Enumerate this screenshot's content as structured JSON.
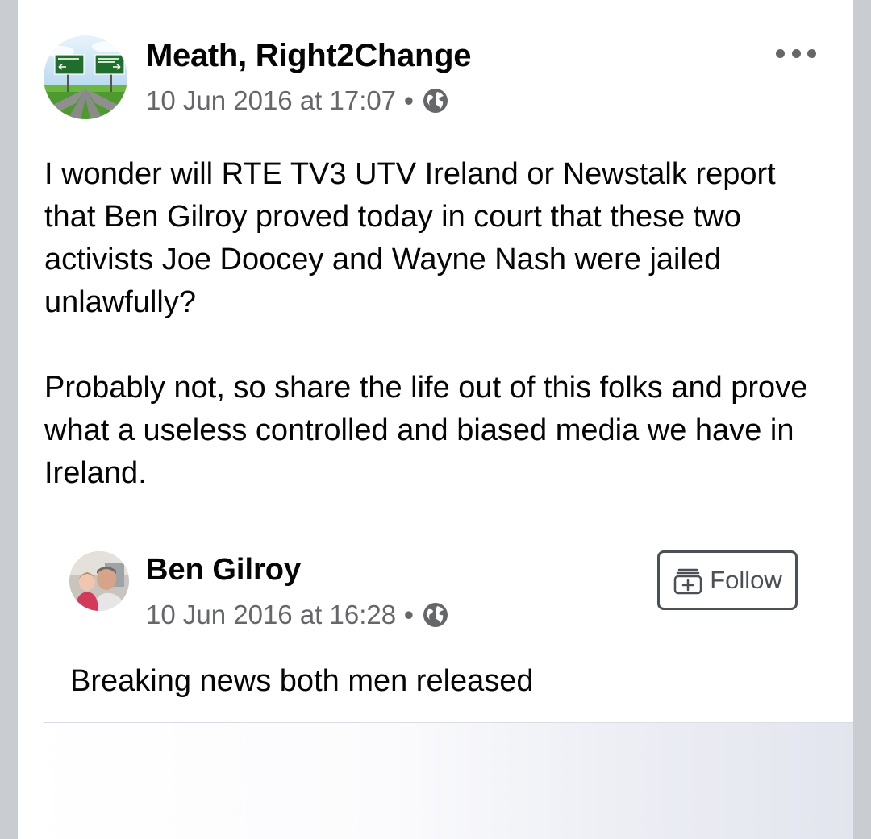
{
  "post": {
    "author": "Meath, Right2Change",
    "timestamp": "10 Jun 2016 at 17:07",
    "separator": "•",
    "audience_icon": "globe-icon",
    "paragraphs": [
      "I wonder will RTE TV3 UTV Ireland or Newstalk report that Ben Gilroy proved today in court that these two activists Joe Doocey and Wayne Nash were jailed unlawfully?",
      "Probably not,  so share the life out of this folks and prove what a useless controlled and biased media we have in Ireland."
    ],
    "more_icon": "more-options-icon"
  },
  "shared_post": {
    "author": "Ben Gilroy",
    "timestamp": "10 Jun 2016 at 16:28",
    "separator": "•",
    "audience_icon": "globe-icon",
    "follow_label": "Follow",
    "follow_icon": "follow-plus-icon",
    "text": "Breaking news both men released"
  },
  "colors": {
    "text_primary": "#050505",
    "text_secondary": "#65676b",
    "background": "#c9ccd1",
    "card": "#ffffff"
  }
}
